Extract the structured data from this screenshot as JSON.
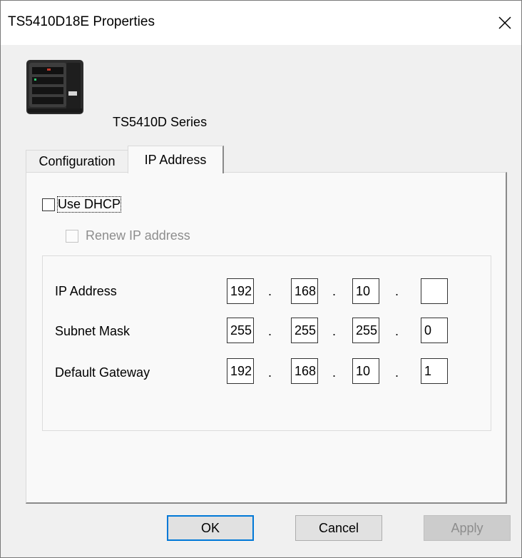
{
  "window": {
    "title": "TS5410D18E Properties"
  },
  "device": {
    "series": "TS5410D Series"
  },
  "tabs": [
    {
      "label": "Configuration",
      "selected": false
    },
    {
      "label": "IP Address",
      "selected": true
    }
  ],
  "dhcp": {
    "label": "Use DHCP",
    "checked": false
  },
  "renew": {
    "label": "Renew IP address",
    "checked": false,
    "enabled": false
  },
  "fields": [
    {
      "label": "IP Address",
      "octets": [
        "192",
        "168",
        "10",
        ""
      ]
    },
    {
      "label": "Subnet Mask",
      "octets": [
        "255",
        "255",
        "255",
        "0"
      ]
    },
    {
      "label": "Default Gateway",
      "octets": [
        "192",
        "168",
        "10",
        "1"
      ]
    }
  ],
  "separator": ".",
  "buttons": {
    "ok": "OK",
    "cancel": "Cancel",
    "apply": "Apply"
  }
}
